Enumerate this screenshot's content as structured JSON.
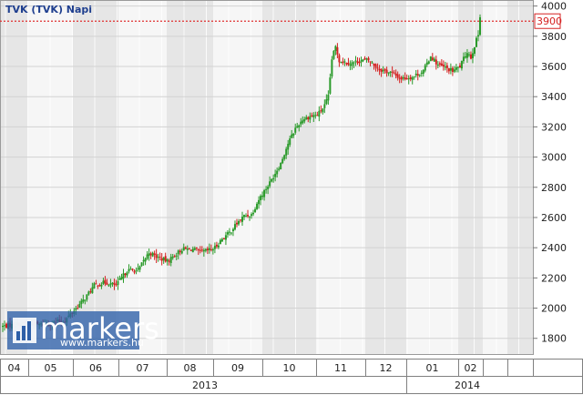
{
  "chart_data": {
    "type": "candlestick",
    "title": "TVK (TVK)  Napi",
    "y_ticks": [
      1800,
      2000,
      2200,
      2400,
      2600,
      2800,
      3000,
      3200,
      3400,
      3600,
      3800,
      4000
    ],
    "ylim": [
      1690,
      4040
    ],
    "reference_line": {
      "value": 3900,
      "label": "3900"
    },
    "months": [
      "04",
      "05",
      "06",
      "07",
      "08",
      "09",
      "10",
      "11",
      "12",
      "01",
      "02"
    ],
    "years": [
      "2013",
      "2014"
    ],
    "grid": true,
    "up_color": "#2a9a2a",
    "down_color": "#d42020",
    "ref_color": "#e03030",
    "close_anchors": [
      [
        0,
        1880
      ],
      [
        12,
        1900
      ],
      [
        22,
        1890
      ],
      [
        34,
        1920
      ],
      [
        44,
        2050
      ],
      [
        50,
        2150
      ],
      [
        56,
        2170
      ],
      [
        62,
        2150
      ],
      [
        68,
        2250
      ],
      [
        74,
        2250
      ],
      [
        80,
        2370
      ],
      [
        84,
        2340
      ],
      [
        90,
        2310
      ],
      [
        98,
        2390
      ],
      [
        104,
        2390
      ],
      [
        108,
        2370
      ],
      [
        112,
        2380
      ],
      [
        116,
        2400
      ],
      [
        120,
        2460
      ],
      [
        124,
        2500
      ],
      [
        128,
        2560
      ],
      [
        132,
        2610
      ],
      [
        136,
        2620
      ],
      [
        140,
        2720
      ],
      [
        146,
        2830
      ],
      [
        152,
        2960
      ],
      [
        156,
        3090
      ],
      [
        160,
        3190
      ],
      [
        164,
        3250
      ],
      [
        168,
        3270
      ],
      [
        172,
        3280
      ],
      [
        176,
        3340
      ],
      [
        178,
        3400
      ],
      [
        180,
        3650
      ],
      [
        182,
        3730
      ],
      [
        184,
        3640
      ],
      [
        190,
        3620
      ],
      [
        196,
        3640
      ],
      [
        200,
        3640
      ],
      [
        206,
        3580
      ],
      [
        212,
        3560
      ],
      [
        218,
        3520
      ],
      [
        224,
        3530
      ],
      [
        230,
        3570
      ],
      [
        234,
        3670
      ],
      [
        238,
        3610
      ],
      [
        242,
        3590
      ],
      [
        246,
        3570
      ],
      [
        250,
        3600
      ],
      [
        254,
        3700
      ],
      [
        256,
        3660
      ],
      [
        258,
        3740
      ],
      [
        260,
        3810
      ],
      [
        261,
        3940
      ]
    ]
  },
  "watermark": {
    "brand": "markers",
    "url": "www.markers.hu"
  }
}
